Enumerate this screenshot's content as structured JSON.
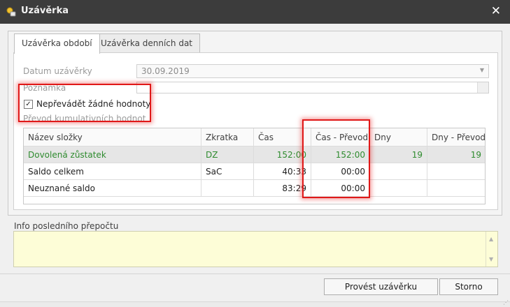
{
  "window": {
    "title": "Uzávěrka",
    "icon": "lock-key-icon",
    "close_glyph": "✕"
  },
  "tabs": [
    {
      "label": "Uzávěrka období",
      "active": true
    },
    {
      "label": "Uzávěrka denních dat",
      "active": false
    }
  ],
  "form": {
    "date_label": "Datum uzávěrky",
    "date_value": "30.09.2019",
    "note_label": "Poznámka",
    "note_value": "",
    "checkbox_label": "Nepřevádět žádné hodnoty",
    "checkbox_checked": true,
    "checkbox_glyph": "✓",
    "section_label": "Převod kumulativních hodnot"
  },
  "grid": {
    "columns": [
      "Název složky",
      "Zkratka",
      "Čas",
      "Čas - Převod",
      "Dny",
      "Dny - Převod"
    ],
    "rows": [
      {
        "name": "Dovolená zůstatek",
        "abbr": "DZ",
        "cas": "152:00",
        "cas_prevod": "152:00",
        "dny": "19",
        "dny_prevod": "19",
        "highlight": true
      },
      {
        "name": "Saldo celkem",
        "abbr": "SaC",
        "cas": "40:33",
        "cas_prevod": "00:00",
        "dny": "",
        "dny_prevod": "",
        "highlight": false
      },
      {
        "name": "Neuznané saldo",
        "abbr": "",
        "cas": "83:29",
        "cas_prevod": "00:00",
        "dny": "",
        "dny_prevod": "",
        "highlight": false
      }
    ]
  },
  "info": {
    "label": "Info posledního přepočtu",
    "value": ""
  },
  "buttons": {
    "run": "Provést uzávěrku",
    "cancel": "Storno"
  },
  "colors": {
    "titlebar": "#3c3c3c",
    "highlight_row_text": "#2e8b2e",
    "info_background": "#fdfdd7",
    "annotation_red": "#e01818"
  }
}
